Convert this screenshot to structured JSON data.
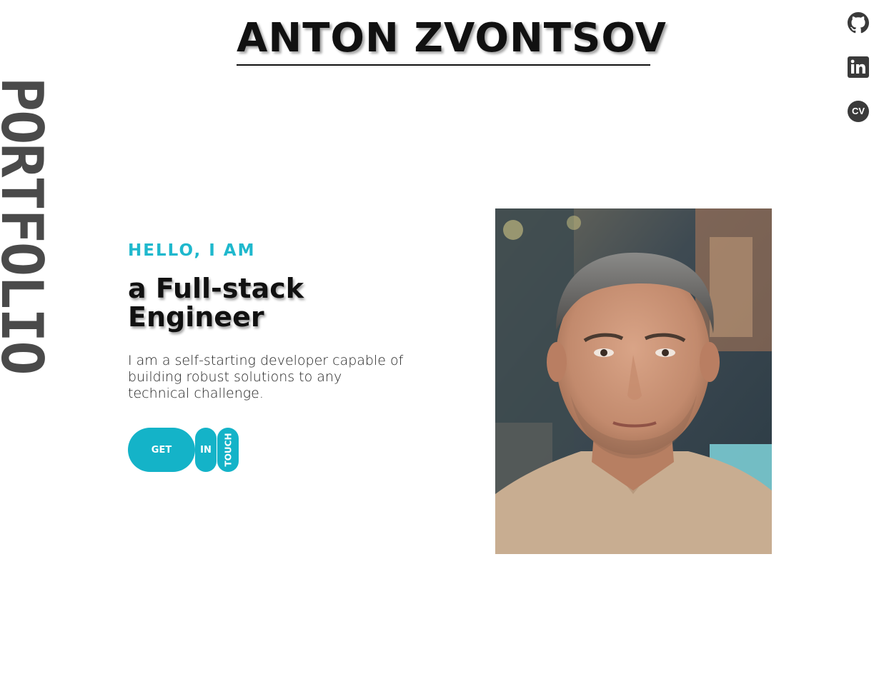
{
  "header": {
    "name": "ANTON ZVONTSOV"
  },
  "sidebar": {
    "vertical_label": "PORTFOLIO"
  },
  "social": {
    "items": [
      {
        "icon": "github-icon",
        "label": "GitHub"
      },
      {
        "icon": "linkedin-icon",
        "label": "LinkedIn"
      },
      {
        "icon": "cv-icon",
        "label": "CV"
      }
    ],
    "cv_text": "CV"
  },
  "hero": {
    "greeting": "HELLO, I AM",
    "role_line1": "a Full-stack",
    "role_line2": "Engineer",
    "tagline": "I am a self-starting developer capable of building robust solutions to any technical challenge.",
    "cta": {
      "get": "GET",
      "in": "IN",
      "touch": "TOUCH"
    }
  },
  "colors": {
    "accent": "#14b3c8",
    "text": "#111111",
    "icon": "#3a3a3a"
  }
}
